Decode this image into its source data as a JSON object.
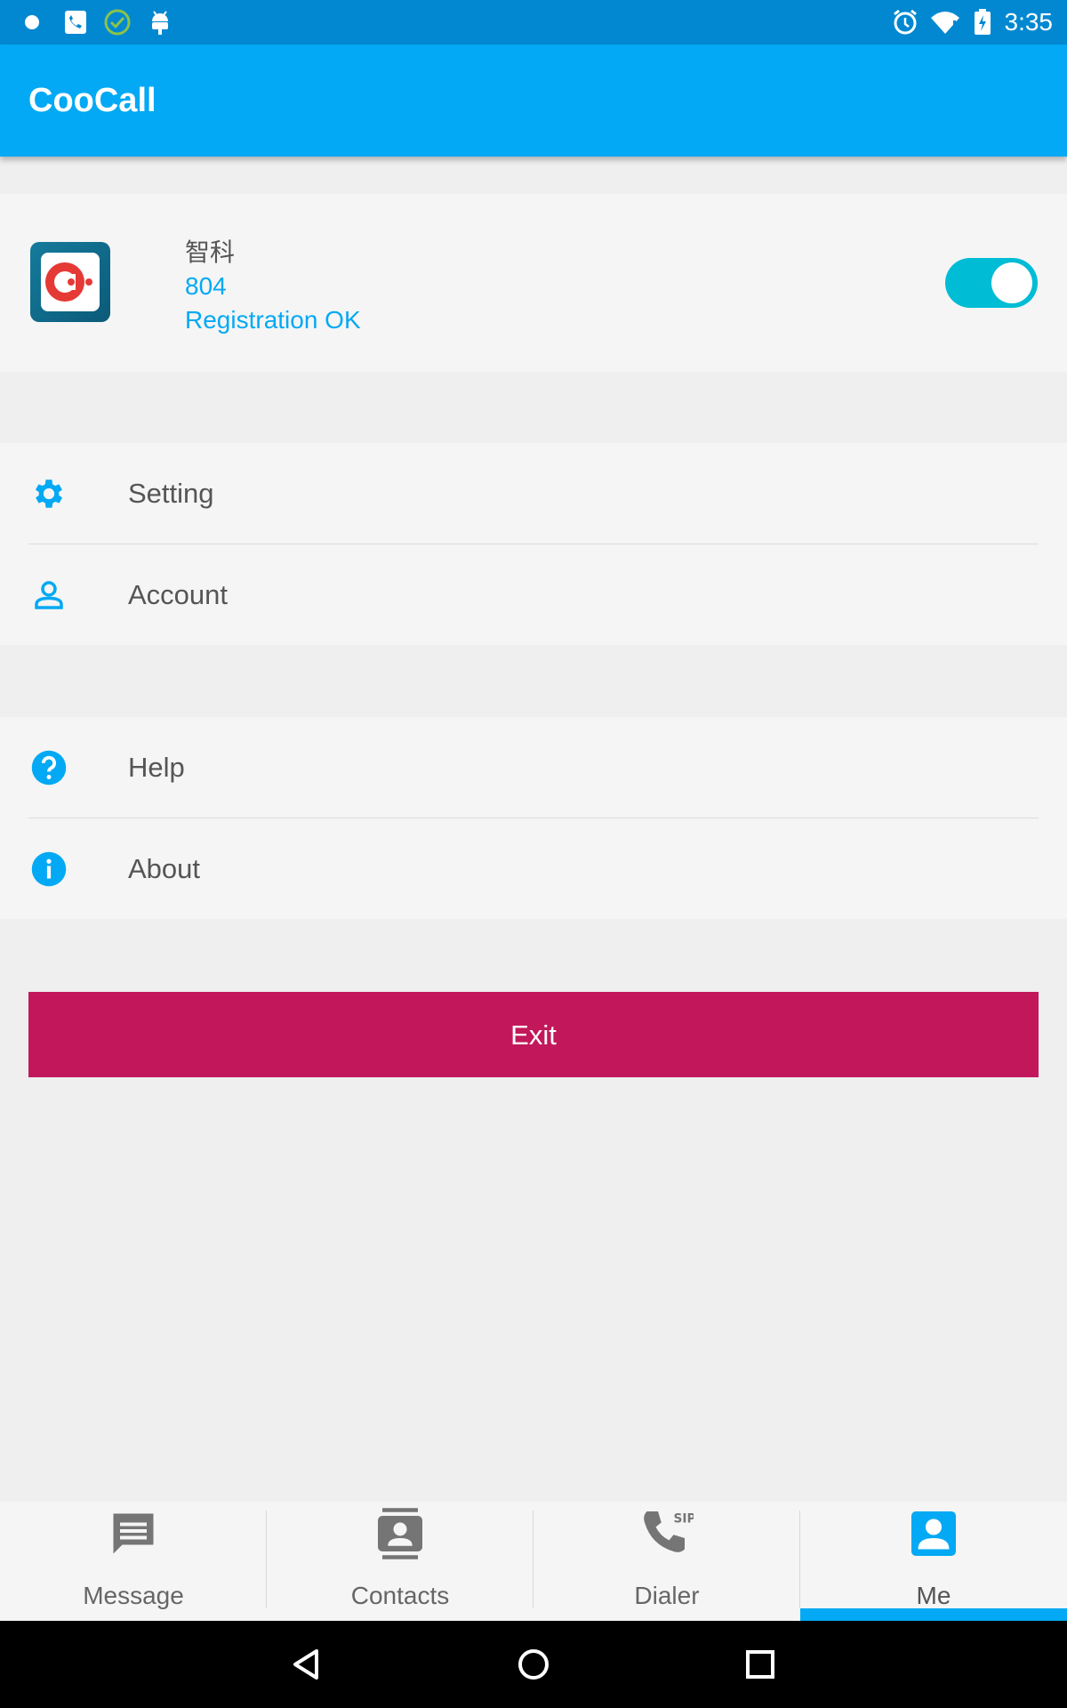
{
  "status_bar": {
    "time": "3:35",
    "left_icons": [
      "notification-dot-icon",
      "sip-phone-icon",
      "check-circle-icon",
      "android-debug-icon"
    ],
    "right_icons": [
      "alarm-icon",
      "wifi-icon",
      "battery-charging-icon"
    ]
  },
  "app_bar": {
    "title": "CooCall"
  },
  "profile": {
    "name": "智科",
    "extension": "804",
    "status": "Registration OK",
    "toggle_on": true
  },
  "menu_group_1": [
    {
      "label": "Setting",
      "icon": "gear-icon"
    },
    {
      "label": "Account",
      "icon": "person-icon"
    }
  ],
  "menu_group_2": [
    {
      "label": "Help",
      "icon": "help-icon"
    },
    {
      "label": "About",
      "icon": "info-icon"
    }
  ],
  "exit_button": {
    "label": "Exit"
  },
  "bottom_nav": {
    "active": "Me",
    "tabs": [
      {
        "label": "Message",
        "icon": "message-icon"
      },
      {
        "label": "Contacts",
        "icon": "contacts-icon"
      },
      {
        "label": "Dialer",
        "icon": "sip-dialer-icon"
      },
      {
        "label": "Me",
        "icon": "me-icon"
      }
    ]
  },
  "colors": {
    "status_bar": "#0288d1",
    "app_bar": "#03a9f4",
    "accent": "#03a9f4",
    "toggle": "#00bcd4",
    "exit": "#c2185b"
  }
}
